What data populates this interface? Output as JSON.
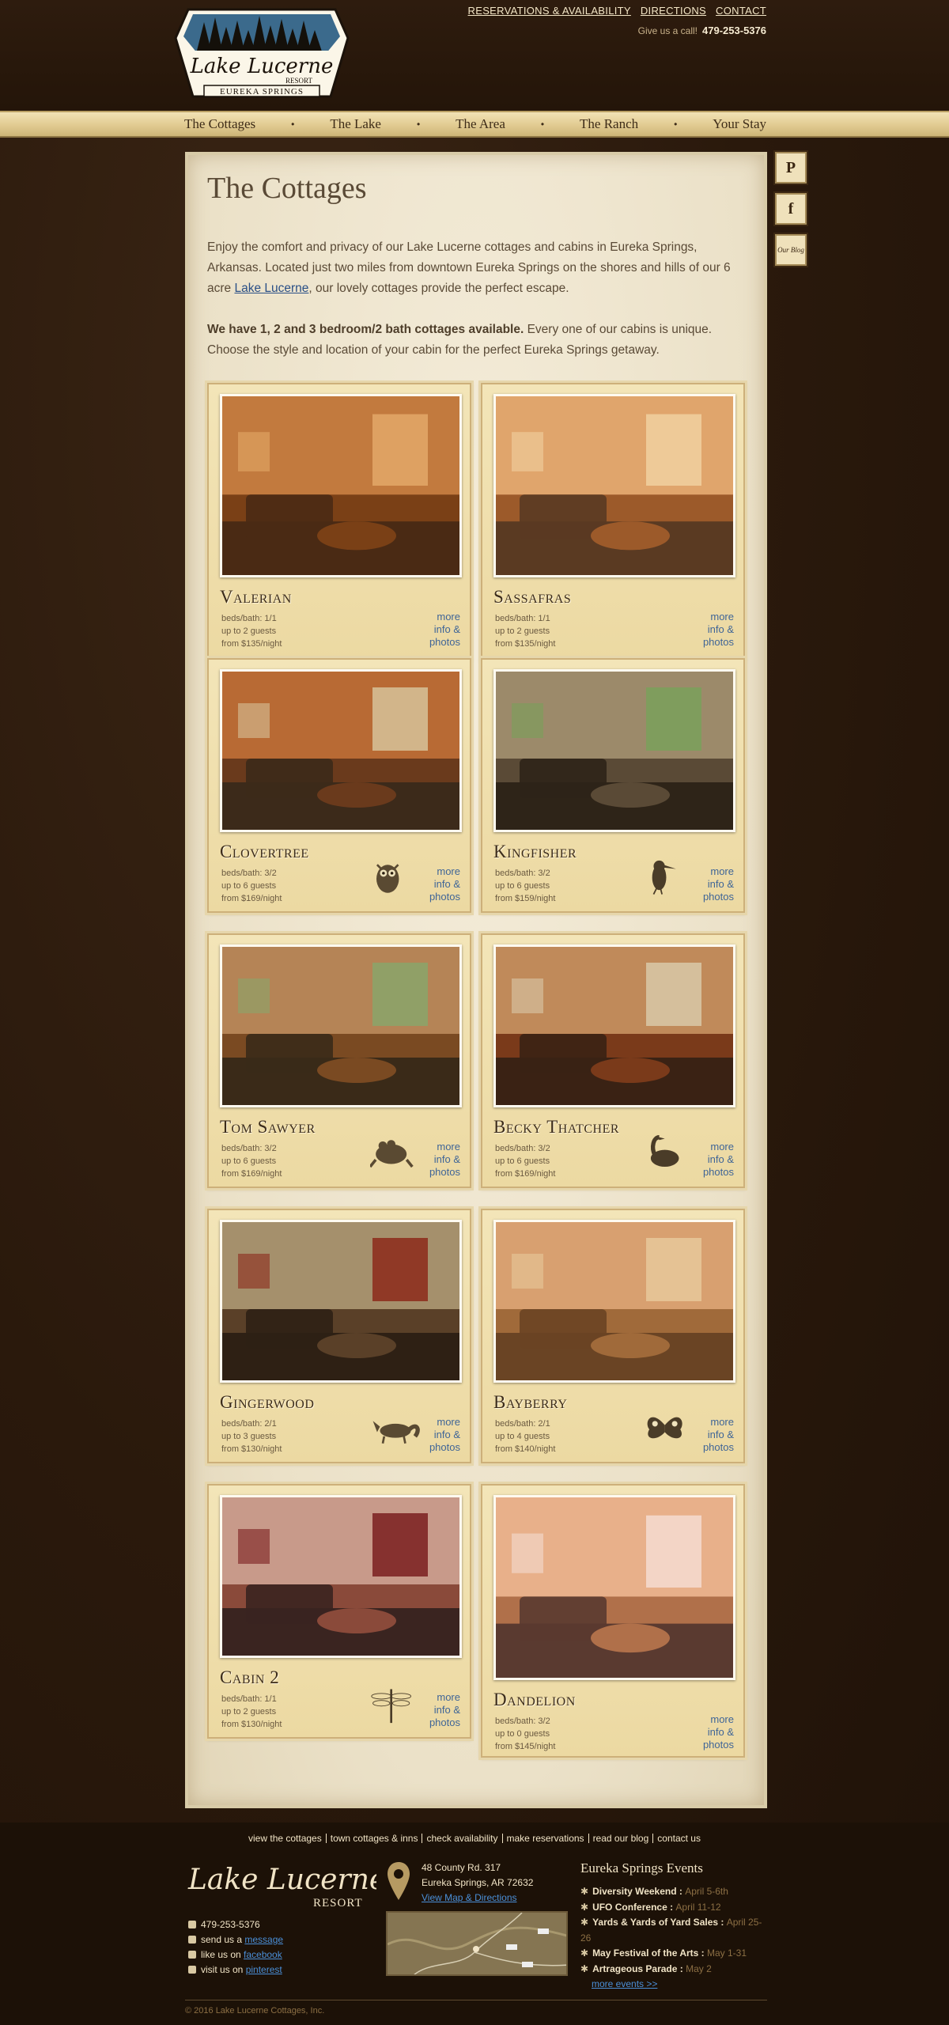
{
  "header": {
    "logo": {
      "line1": "Lake Lucerne",
      "line2": "RESORT",
      "line3": "EUREKA SPRINGS"
    },
    "top_links": [
      "RESERVATIONS & AVAILABILITY",
      "DIRECTIONS",
      "CONTACT"
    ],
    "call_label": "Give us a call!",
    "phone": "479-253-5376"
  },
  "nav": {
    "items": [
      "The Cottages",
      "The Lake",
      "The Area",
      "The Ranch",
      "Your Stay"
    ],
    "separator": "•"
  },
  "social": {
    "pinterest": "P",
    "facebook": "f",
    "blog": "Our Blog"
  },
  "main": {
    "title": "The Cottages",
    "intro_before": "Enjoy the comfort and privacy of our Lake Lucerne cottages and cabins in Eureka Springs, Arkansas. Located just two miles from downtown Eureka Springs on the shores and hills of our 6 acre ",
    "intro_link": "Lake Lucerne",
    "intro_after": ", our lovely cottages provide the perfect escape.",
    "intro2_bold": "We have 1, 2 and 3 bedroom/2 bath cottages available.",
    "intro2_rest": " Every one of our cabins is unique. Choose the style and location of your cabin for the perfect Eureka Springs getaway."
  },
  "cottages": [
    {
      "name": "Valerian",
      "beds": "beds/bath: 1/1",
      "guests": "up to 2 guests",
      "price": "from $135/night",
      "more": [
        "more",
        "info &",
        "photos"
      ],
      "critter": "",
      "palette": [
        "#7a4016",
        "#c27a3e",
        "#4a2a14",
        "#e3a868"
      ]
    },
    {
      "name": "Sassafras",
      "beds": "beds/bath: 1/1",
      "guests": "up to 2 guests",
      "price": "from $135/night",
      "more": [
        "more",
        "info &",
        "photos"
      ],
      "critter": "",
      "palette": [
        "#9c5a2a",
        "#e0a56c",
        "#5a3a22",
        "#f0d0a0"
      ]
    },
    {
      "name": "Clovertree",
      "beds": "beds/bath: 3/2",
      "guests": "up to 6 guests",
      "price": "from $169/night",
      "more": [
        "more",
        "info &",
        "photos"
      ],
      "critter": "owl-icon",
      "palette": [
        "#6a3a1c",
        "#b86a34",
        "#3c2a1a",
        "#d6c29a"
      ]
    },
    {
      "name": "Kingfisher",
      "beds": "beds/bath: 3/2",
      "guests": "up to 6 guests",
      "price": "from $159/night",
      "more": [
        "more",
        "info &",
        "photos"
      ],
      "critter": "kingfisher-icon",
      "palette": [
        "#5a4a36",
        "#9c8a6a",
        "#2e2418",
        "#7aa05a"
      ]
    },
    {
      "name": "Tom Sawyer",
      "beds": "beds/bath: 3/2",
      "guests": "up to 6 guests",
      "price": "from $169/night",
      "more": [
        "more",
        "info &",
        "photos"
      ],
      "critter": "frog-icon",
      "palette": [
        "#7a4a22",
        "#b58456",
        "#3a2a18",
        "#8aa56a"
      ]
    },
    {
      "name": "Becky Thatcher",
      "beds": "beds/bath: 3/2",
      "guests": "up to 6 guests",
      "price": "from $169/night",
      "more": [
        "more",
        "info &",
        "photos"
      ],
      "critter": "goose-icon",
      "palette": [
        "#7a3a1a",
        "#c08a5a",
        "#3a2214",
        "#d8c8a8"
      ]
    },
    {
      "name": "Gingerwood",
      "beds": "beds/bath: 2/1",
      "guests": "up to 3 guests",
      "price": "from $130/night",
      "more": [
        "more",
        "info &",
        "photos"
      ],
      "critter": "fox-icon",
      "palette": [
        "#5a4028",
        "#a5906c",
        "#2e2014",
        "#8c2a1a"
      ]
    },
    {
      "name": "Bayberry",
      "beds": "beds/bath: 2/1",
      "guests": "up to 4 guests",
      "price": "from $140/night",
      "more": [
        "more",
        "info &",
        "photos"
      ],
      "critter": "butterfly-icon",
      "palette": [
        "#a06a3a",
        "#d8a070",
        "#6a4424",
        "#e8c89a"
      ]
    },
    {
      "name": "Cabin 2",
      "beds": "beds/bath: 1/1",
      "guests": "up to 2 guests",
      "price": "from $130/night",
      "more": [
        "more",
        "info &",
        "photos"
      ],
      "critter": "dragonfly-icon",
      "palette": [
        "#8a4a3a",
        "#c89a8a",
        "#3a2420",
        "#7a1e1e"
      ]
    },
    {
      "name": "Dandelion",
      "beds": "beds/bath: 3/2",
      "guests": "up to 0 guests",
      "price": "from $145/night",
      "more": [
        "more",
        "info &",
        "photos"
      ],
      "critter": "",
      "palette": [
        "#b0704a",
        "#e8b08a",
        "#5a3a30",
        "#f4dcd0"
      ]
    }
  ],
  "footer": {
    "links": [
      "view the cottages",
      "town cottages & inns",
      "check availability",
      "make reservations",
      "read our blog",
      "contact us"
    ],
    "logo": {
      "line1": "Lake Lucerne",
      "line2": "RESORT"
    },
    "phone": "479-253-5376",
    "send_prefix": "send us a ",
    "send_link": "message",
    "like_prefix": "like us on ",
    "like_link": "facebook",
    "visit_prefix": "visit us on ",
    "visit_link": "pinterest",
    "address_line1": "48 County Rd. 317",
    "address_line2": "Eureka Springs, AR  72632",
    "map_link": "View Map & Directions",
    "events_title": "Eureka Springs Events",
    "events": [
      {
        "name": "Diversity Weekend",
        "date": "April 5-6th"
      },
      {
        "name": "UFO Conference",
        "date": "April 11-12"
      },
      {
        "name": "Yards & Yards of Yard Sales",
        "date": "April 25-26"
      },
      {
        "name": "May Festival of the Arts",
        "date": "May 1-31"
      },
      {
        "name": "Artrageous Parade",
        "date": "May 2"
      }
    ],
    "more_events": "more events >>",
    "copyright": "© 2016 Lake Lucerne Cottages, Inc."
  }
}
